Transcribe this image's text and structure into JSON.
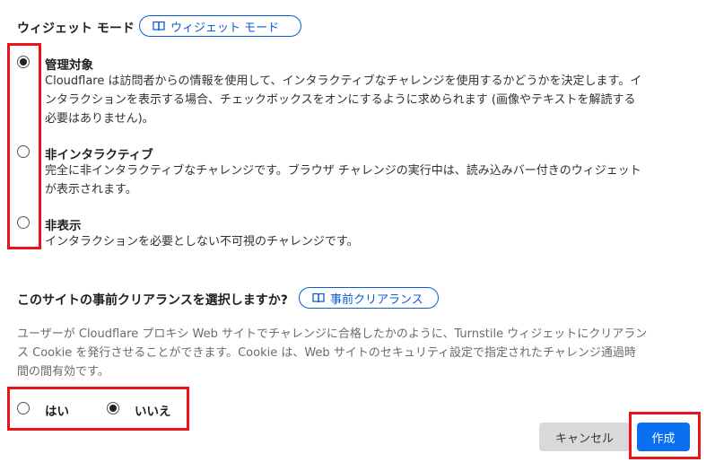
{
  "widget_mode": {
    "title": "ウィジェット モード",
    "doc_link_label": "ウィジェット モード",
    "selected": "managed",
    "options": [
      {
        "id": "managed",
        "title": "管理対象",
        "desc_lines": [
          "Cloudflare は訪問者からの情報を使用して、インタラクティブなチャレンジを使用するかどうかを決定します。イ",
          "ンタラクションを表示する場合、チェックボックスをオンにするように求められます (画像やテキストを解読する",
          "必要はありません)。"
        ]
      },
      {
        "id": "non_interactive",
        "title": "非インタラクティブ",
        "desc_lines": [
          "完全に非インタラクティブなチャレンジです。ブラウザ チャレンジの実行中は、読み込みバー付きのウィジェット",
          "が表示されます。"
        ]
      },
      {
        "id": "invisible",
        "title": "非表示",
        "desc_lines": [
          "インタラクションを必要としない不可視のチャレンジです。"
        ]
      }
    ]
  },
  "pre_clearance": {
    "question": "このサイトの事前クリアランスを選択しますか?",
    "doc_link_label": "事前クリアランス",
    "desc_lines": [
      "ユーザーが Cloudflare プロキシ Web サイトでチャレンジに合格したかのように、Turnstile ウィジェットにクリアラン",
      "ス Cookie を発行させることができます。Cookie は、Web サイトのセキュリティ設定で指定されたチャレンジ通過時",
      "間の間有効です。"
    ],
    "yes_label": "はい",
    "no_label": "いいえ",
    "selected": "no"
  },
  "footer": {
    "cancel_label": "キャンセル",
    "create_label": "作成"
  },
  "colors": {
    "accent": "#0a5bd6",
    "primary_button": "#0a6ff0",
    "highlight_box": "#e8141a"
  },
  "icons": {
    "doc_link": "book-icon"
  }
}
